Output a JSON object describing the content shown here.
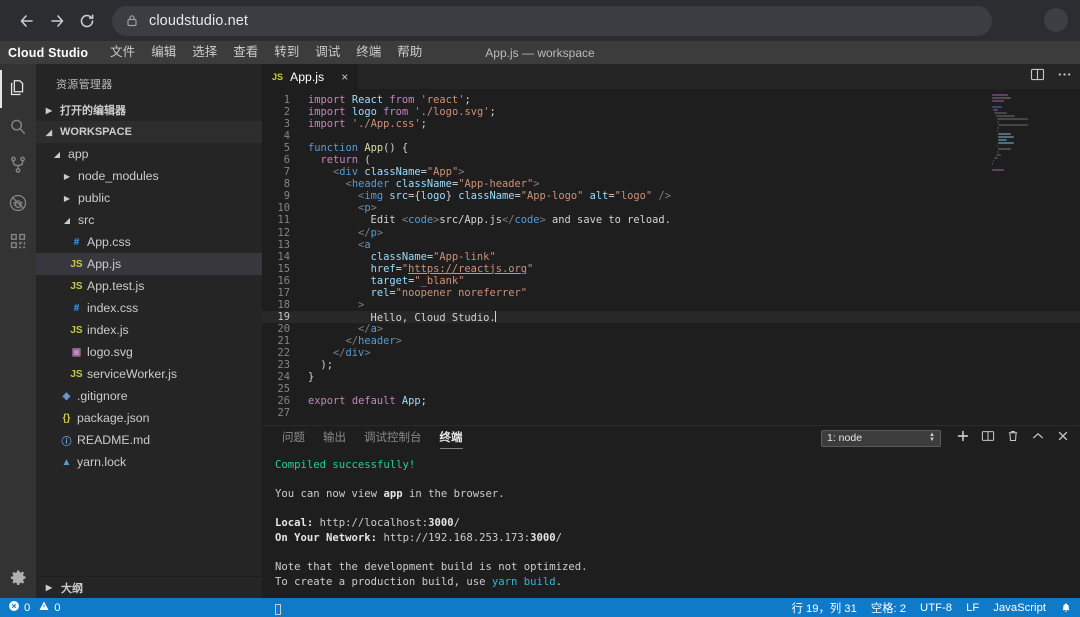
{
  "browser": {
    "back_icon": "arrow-left-icon",
    "forward_icon": "arrow-right-icon",
    "reload_icon": "reload-icon",
    "lock_icon": "lock-icon",
    "url": "cloudstudio.net",
    "avatar": "profile-avatar"
  },
  "titlebar": {
    "brand": "Cloud Studio",
    "menus": [
      "文件",
      "编辑",
      "选择",
      "查看",
      "转到",
      "调试",
      "终端",
      "帮助"
    ],
    "window_title": "App.js — workspace"
  },
  "activitybar": {
    "items": [
      {
        "name": "explorer",
        "icon": "files-icon",
        "active": true
      },
      {
        "name": "search",
        "icon": "search-icon",
        "active": false
      },
      {
        "name": "source-control",
        "icon": "source-control-icon",
        "active": false
      },
      {
        "name": "debug",
        "icon": "debug-icon",
        "active": false
      },
      {
        "name": "extensions",
        "icon": "extensions-icon",
        "active": false
      }
    ],
    "settings_icon": "gear-icon"
  },
  "sidebar": {
    "title": "资源管理器",
    "open_editors_label": "打开的编辑器",
    "workspace_label": "WORKSPACE",
    "outline_label": "大纲",
    "tree": [
      {
        "label": "app",
        "icon": "folder",
        "indent": 1,
        "expanded": true,
        "selected": false
      },
      {
        "label": "node_modules",
        "icon": "folder",
        "indent": 2,
        "expanded": false,
        "selected": false
      },
      {
        "label": "public",
        "icon": "folder",
        "indent": 2,
        "expanded": false,
        "selected": false
      },
      {
        "label": "src",
        "icon": "folder",
        "indent": 2,
        "expanded": true,
        "selected": false
      },
      {
        "label": "App.css",
        "icon": "css",
        "indent": 3,
        "selected": false
      },
      {
        "label": "App.js",
        "icon": "js",
        "indent": 3,
        "selected": true
      },
      {
        "label": "App.test.js",
        "icon": "js",
        "indent": 3,
        "selected": false
      },
      {
        "label": "index.css",
        "icon": "css",
        "indent": 3,
        "selected": false
      },
      {
        "label": "index.js",
        "icon": "js",
        "indent": 3,
        "selected": false
      },
      {
        "label": "logo.svg",
        "icon": "svg",
        "indent": 3,
        "selected": false
      },
      {
        "label": "serviceWorker.js",
        "icon": "js",
        "indent": 3,
        "selected": false
      },
      {
        "label": ".gitignore",
        "icon": "git",
        "indent": 2,
        "selected": false
      },
      {
        "label": "package.json",
        "icon": "json",
        "indent": 2,
        "selected": false
      },
      {
        "label": "README.md",
        "icon": "md",
        "indent": 2,
        "selected": false
      },
      {
        "label": "yarn.lock",
        "icon": "yarn",
        "indent": 2,
        "selected": false
      }
    ]
  },
  "editor": {
    "tab": {
      "label": "App.js",
      "badge": "JS",
      "close": "×"
    },
    "split_icon": "split-editor-icon",
    "more_icon": "more-actions-icon",
    "code_lines": [
      {
        "n": 1,
        "tokens": [
          [
            "kw",
            "import"
          ],
          [
            "plain",
            " "
          ],
          [
            "var",
            "React"
          ],
          [
            "plain",
            " "
          ],
          [
            "kw",
            "from"
          ],
          [
            "plain",
            " "
          ],
          [
            "str",
            "'react'"
          ],
          [
            "plain",
            ";"
          ]
        ]
      },
      {
        "n": 2,
        "tokens": [
          [
            "kw",
            "import"
          ],
          [
            "plain",
            " "
          ],
          [
            "var",
            "logo"
          ],
          [
            "plain",
            " "
          ],
          [
            "kw",
            "from"
          ],
          [
            "plain",
            " "
          ],
          [
            "str",
            "'./logo.svg'"
          ],
          [
            "plain",
            ";"
          ]
        ]
      },
      {
        "n": 3,
        "tokens": [
          [
            "kw",
            "import"
          ],
          [
            "plain",
            " "
          ],
          [
            "str",
            "'./App.css'"
          ],
          [
            "plain",
            ";"
          ]
        ]
      },
      {
        "n": 4,
        "tokens": []
      },
      {
        "n": 5,
        "tokens": [
          [
            "kw2",
            "function"
          ],
          [
            "plain",
            " "
          ],
          [
            "fn",
            "App"
          ],
          [
            "plain",
            "() {"
          ]
        ]
      },
      {
        "n": 6,
        "tokens": [
          [
            "plain",
            "  "
          ],
          [
            "kw",
            "return"
          ],
          [
            "plain",
            " ("
          ]
        ]
      },
      {
        "n": 7,
        "tokens": [
          [
            "plain",
            "    "
          ],
          [
            "tag",
            "<"
          ],
          [
            "tagname",
            "div"
          ],
          [
            "plain",
            " "
          ],
          [
            "attr",
            "className"
          ],
          [
            "plain",
            "="
          ],
          [
            "str",
            "\"App\""
          ],
          [
            "tag",
            ">"
          ]
        ]
      },
      {
        "n": 8,
        "tokens": [
          [
            "plain",
            "      "
          ],
          [
            "tag",
            "<"
          ],
          [
            "tagname",
            "header"
          ],
          [
            "plain",
            " "
          ],
          [
            "attr",
            "className"
          ],
          [
            "plain",
            "="
          ],
          [
            "str",
            "\"App-header\""
          ],
          [
            "tag",
            ">"
          ]
        ]
      },
      {
        "n": 9,
        "tokens": [
          [
            "plain",
            "        "
          ],
          [
            "tag",
            "<"
          ],
          [
            "tagname",
            "img"
          ],
          [
            "plain",
            " "
          ],
          [
            "attr",
            "src"
          ],
          [
            "plain",
            "={"
          ],
          [
            "var",
            "logo"
          ],
          [
            "plain",
            "} "
          ],
          [
            "attr",
            "className"
          ],
          [
            "plain",
            "="
          ],
          [
            "str",
            "\"App-logo\""
          ],
          [
            "plain",
            " "
          ],
          [
            "attr",
            "alt"
          ],
          [
            "plain",
            "="
          ],
          [
            "str",
            "\"logo\""
          ],
          [
            "plain",
            " "
          ],
          [
            "tag",
            "/>"
          ]
        ]
      },
      {
        "n": 10,
        "tokens": [
          [
            "plain",
            "        "
          ],
          [
            "tag",
            "<"
          ],
          [
            "tagname",
            "p"
          ],
          [
            "tag",
            ">"
          ]
        ]
      },
      {
        "n": 11,
        "tokens": [
          [
            "plain",
            "          Edit "
          ],
          [
            "tag",
            "<"
          ],
          [
            "tagname",
            "code"
          ],
          [
            "tag",
            ">"
          ],
          [
            "plain",
            "src/App.js"
          ],
          [
            "tag",
            "</"
          ],
          [
            "tagname",
            "code"
          ],
          [
            "tag",
            ">"
          ],
          [
            "plain",
            " and save to reload."
          ]
        ]
      },
      {
        "n": 12,
        "tokens": [
          [
            "plain",
            "        "
          ],
          [
            "tag",
            "</"
          ],
          [
            "tagname",
            "p"
          ],
          [
            "tag",
            ">"
          ]
        ]
      },
      {
        "n": 13,
        "tokens": [
          [
            "plain",
            "        "
          ],
          [
            "tag",
            "<"
          ],
          [
            "tagname",
            "a"
          ]
        ]
      },
      {
        "n": 14,
        "tokens": [
          [
            "plain",
            "          "
          ],
          [
            "attr",
            "className"
          ],
          [
            "plain",
            "="
          ],
          [
            "str",
            "\"App-link\""
          ]
        ]
      },
      {
        "n": 15,
        "tokens": [
          [
            "plain",
            "          "
          ],
          [
            "attr",
            "href"
          ],
          [
            "plain",
            "="
          ],
          [
            "str",
            "\""
          ],
          [
            "link",
            "https://reactjs.org"
          ],
          [
            "str",
            "\""
          ]
        ]
      },
      {
        "n": 16,
        "tokens": [
          [
            "plain",
            "          "
          ],
          [
            "attr",
            "target"
          ],
          [
            "plain",
            "="
          ],
          [
            "str",
            "\"_blank\""
          ]
        ]
      },
      {
        "n": 17,
        "tokens": [
          [
            "plain",
            "          "
          ],
          [
            "attr",
            "rel"
          ],
          [
            "plain",
            "="
          ],
          [
            "str",
            "\"noopener noreferrer\""
          ]
        ]
      },
      {
        "n": 18,
        "tokens": [
          [
            "plain",
            "        "
          ],
          [
            "tag",
            ">"
          ]
        ]
      },
      {
        "n": 19,
        "tokens": [
          [
            "plain",
            "          Hello, Cloud Studio."
          ]
        ],
        "active": true,
        "cursor": true
      },
      {
        "n": 20,
        "tokens": [
          [
            "plain",
            "        "
          ],
          [
            "tag",
            "</"
          ],
          [
            "tagname",
            "a"
          ],
          [
            "tag",
            ">"
          ]
        ]
      },
      {
        "n": 21,
        "tokens": [
          [
            "plain",
            "      "
          ],
          [
            "tag",
            "</"
          ],
          [
            "tagname",
            "header"
          ],
          [
            "tag",
            ">"
          ]
        ]
      },
      {
        "n": 22,
        "tokens": [
          [
            "plain",
            "    "
          ],
          [
            "tag",
            "</"
          ],
          [
            "tagname",
            "div"
          ],
          [
            "tag",
            ">"
          ]
        ]
      },
      {
        "n": 23,
        "tokens": [
          [
            "plain",
            "  );"
          ]
        ]
      },
      {
        "n": 24,
        "tokens": [
          [
            "plain",
            "}"
          ]
        ]
      },
      {
        "n": 25,
        "tokens": []
      },
      {
        "n": 26,
        "tokens": [
          [
            "kw",
            "export"
          ],
          [
            "plain",
            " "
          ],
          [
            "kw",
            "default"
          ],
          [
            "plain",
            " "
          ],
          [
            "var",
            "App"
          ],
          [
            "plain",
            ";"
          ]
        ]
      },
      {
        "n": 27,
        "tokens": []
      }
    ]
  },
  "panel": {
    "tabs": [
      {
        "label": "问题",
        "active": false
      },
      {
        "label": "输出",
        "active": false
      },
      {
        "label": "调试控制台",
        "active": false
      },
      {
        "label": "终端",
        "active": true
      }
    ],
    "terminal_select": "1: node",
    "actions": [
      {
        "name": "new-terminal",
        "icon": "plus-icon"
      },
      {
        "name": "split-terminal",
        "icon": "split-icon"
      },
      {
        "name": "kill-terminal",
        "icon": "trash-icon"
      },
      {
        "name": "maximize-panel",
        "icon": "chevron-up-icon"
      },
      {
        "name": "close-panel",
        "icon": "close-icon"
      }
    ],
    "terminal_lines": [
      {
        "type": "green",
        "text": "Compiled successfully!"
      },
      {
        "type": "blank"
      },
      {
        "type": "mixed",
        "parts": [
          [
            "plain",
            "You can now view "
          ],
          [
            "bold",
            "app"
          ],
          [
            "plain",
            " in the browser."
          ]
        ]
      },
      {
        "type": "blank"
      },
      {
        "type": "mixed",
        "parts": [
          [
            "bold",
            "  Local:"
          ],
          [
            "plain",
            "            http://localhost:"
          ],
          [
            "bold",
            "3000"
          ],
          [
            "plain",
            "/"
          ]
        ]
      },
      {
        "type": "mixed",
        "parts": [
          [
            "bold",
            "  On Your Network:"
          ],
          [
            "plain",
            "  http://192.168.253.173:"
          ],
          [
            "bold",
            "3000"
          ],
          [
            "plain",
            "/"
          ]
        ]
      },
      {
        "type": "blank"
      },
      {
        "type": "plain",
        "text": "Note that the development build is not optimized."
      },
      {
        "type": "mixed",
        "parts": [
          [
            "plain",
            "To create a production build, use "
          ],
          [
            "cyan",
            "yarn build"
          ],
          [
            "plain",
            "."
          ]
        ]
      },
      {
        "type": "blank"
      },
      {
        "type": "cursor"
      }
    ]
  },
  "statusbar": {
    "errors_icon": "error-icon",
    "errors": "0",
    "warnings_icon": "warning-icon",
    "warnings": "0",
    "position": "行 19，列 31",
    "indent": "空格: 2",
    "encoding": "UTF-8",
    "eol": "LF",
    "language": "JavaScript",
    "bell_icon": "bell-icon",
    "accent_color": "#0f7ac8"
  }
}
